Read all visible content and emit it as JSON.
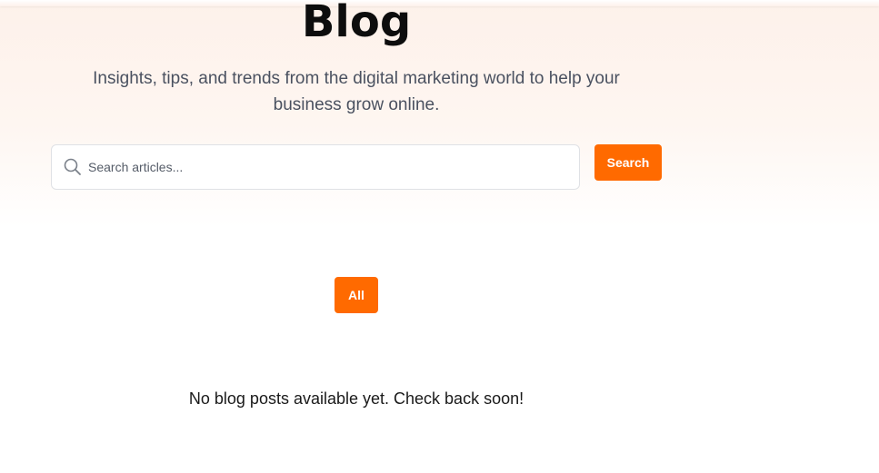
{
  "hero": {
    "title": "Blog",
    "subtitle": "Insights, tips, and trends from the digital marketing world to help your business grow online."
  },
  "search": {
    "placeholder": "Search articles...",
    "value": "",
    "button_label": "Search",
    "icon": "search-icon"
  },
  "filters": {
    "items": [
      {
        "label": "All",
        "active": true
      }
    ]
  },
  "empty_state": {
    "message": "No blog posts available yet. Check back soon!"
  },
  "colors": {
    "accent": "#ff6a00",
    "hero_bg": "#fdf1ea",
    "title": "#0d0d0d",
    "subtitle": "#4a5160"
  }
}
